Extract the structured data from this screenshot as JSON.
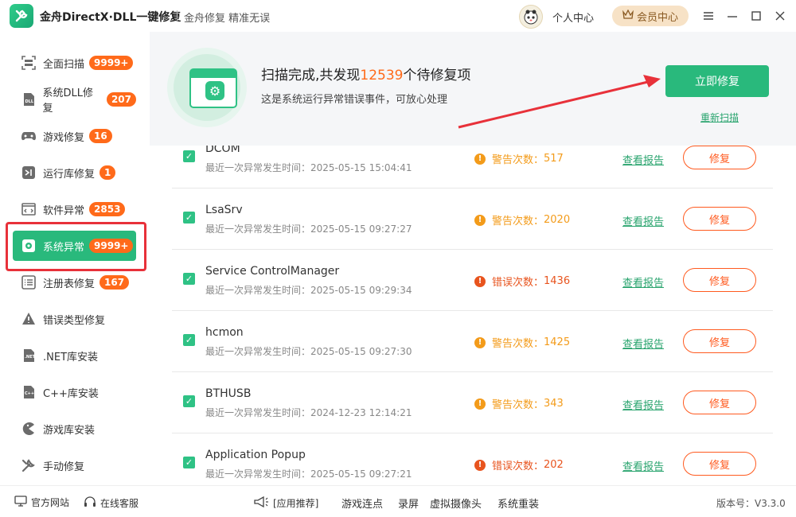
{
  "app": {
    "title": "金舟DirectX·DLL一键修复",
    "slogan": "金舟修复 精准无误",
    "personal_center": "个人中心",
    "vip_center": "会员中心"
  },
  "sidebar": {
    "items": [
      {
        "label": "全面扫描",
        "badge": "9999+",
        "icon": "scan-icon"
      },
      {
        "label": "系统DLL修复",
        "badge": "207",
        "icon": "dll-icon"
      },
      {
        "label": "游戏修复",
        "badge": "16",
        "icon": "gamepad-icon"
      },
      {
        "label": "运行库修复",
        "badge": "1",
        "icon": "vs-icon"
      },
      {
        "label": "软件异常",
        "badge": "2853",
        "icon": "code-window-icon"
      },
      {
        "label": "系统异常",
        "badge": "9999+",
        "icon": "gear-icon",
        "active": true
      },
      {
        "label": "注册表修复",
        "badge": "167",
        "icon": "list-icon"
      },
      {
        "label": "错误类型修复",
        "badge": "",
        "icon": "warning-icon"
      },
      {
        "label": ".NET库安装",
        "badge": "",
        "icon": "net-icon"
      },
      {
        "label": "C++库安装",
        "badge": "",
        "icon": "cpp-icon"
      },
      {
        "label": "游戏库安装",
        "badge": "",
        "icon": "pacman-icon"
      },
      {
        "label": "手动修复",
        "badge": "",
        "icon": "tools-icon"
      }
    ]
  },
  "scan": {
    "title_prefix": "扫描完成,共发现",
    "count": "12539",
    "title_suffix": "个待修复项",
    "subtitle": "这是系统运行异常错误事件，可放心处理",
    "fix_now": "立即修复",
    "rescan": "重新扫描"
  },
  "list": {
    "time_prefix": "最近一次异常发生时间：",
    "report_label": "查看报告",
    "fix_label": "修复",
    "rows": [
      {
        "name": "DCOM",
        "time": "2025-05-15 15:04:41",
        "kind": "警告次数：",
        "count": "517",
        "level": "warn"
      },
      {
        "name": "LsaSrv",
        "time": "2025-05-15 09:27:27",
        "kind": "警告次数：",
        "count": "2020",
        "level": "warn"
      },
      {
        "name": "Service ControlManager",
        "time": "2025-05-15 09:29:34",
        "kind": "错误次数：",
        "count": "1436",
        "level": "err"
      },
      {
        "name": "hcmon",
        "time": "2025-05-15 09:27:30",
        "kind": "警告次数：",
        "count": "1425",
        "level": "warn"
      },
      {
        "name": "BTHUSB",
        "time": "2024-12-23 12:14:21",
        "kind": "警告次数：",
        "count": "343",
        "level": "warn"
      },
      {
        "name": "Application Popup",
        "time": "2025-05-15 09:27:21",
        "kind": "错误次数：",
        "count": "202",
        "level": "err"
      }
    ]
  },
  "footer": {
    "official_site": "官方网站",
    "online_service": "在线客服",
    "recommend": "[应用推荐]",
    "links": [
      "游戏连点",
      "录屏",
      "虚拟摄像头",
      "系统重装"
    ],
    "version": "版本号：V3.3.0"
  },
  "colors": {
    "accent": "#29b97c",
    "badge": "#ff6a1a",
    "warn": "#f39b1a",
    "error": "#e8541e",
    "highlight": "#e8313a"
  }
}
